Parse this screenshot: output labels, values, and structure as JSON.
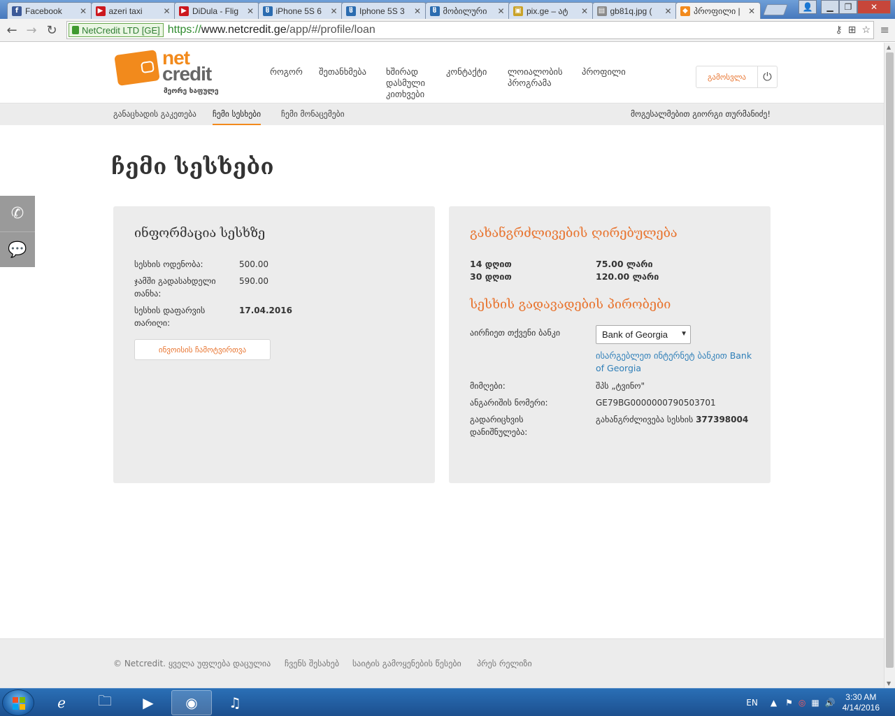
{
  "browser": {
    "tabs": [
      {
        "title": "Facebook",
        "favicon": "facebook-icon",
        "color": "#3b5998",
        "glyph": "f"
      },
      {
        "title": "azeri taxi",
        "favicon": "youtube-icon",
        "color": "#cc181e",
        "glyph": "▶"
      },
      {
        "title": "DiDula - Flig",
        "favicon": "youtube-icon",
        "color": "#cc181e",
        "glyph": "▶"
      },
      {
        "title": "iPhone 5S 6",
        "favicon": "ss-ge-icon",
        "color": "#2b6cb0",
        "glyph": "ჱ"
      },
      {
        "title": "Iphone 5S 3",
        "favicon": "ss-ge-icon",
        "color": "#2b6cb0",
        "glyph": "ჱ"
      },
      {
        "title": "მობილური",
        "favicon": "ss-ge-icon",
        "color": "#2b6cb0",
        "glyph": "ჱ"
      },
      {
        "title": "pix.ge – ატ",
        "favicon": "pix-ge-icon",
        "color": "#c9a227",
        "glyph": "▣"
      },
      {
        "title": "gb81q.jpg (",
        "favicon": "image-file-icon",
        "color": "#8a8a8a",
        "glyph": "▤"
      },
      {
        "title": "პროფილი |",
        "favicon": "netcredit-icon",
        "color": "#f28a1c",
        "glyph": "◆",
        "active": true
      }
    ],
    "ev_owner": "NetCredit LTD [GE]",
    "url_proto": "https://",
    "url_host": "www.netcredit.ge",
    "url_path": "/app/#/profile/loan"
  },
  "site": {
    "logo_net": "net",
    "logo_credit": "credit",
    "logo_tagline": "მეორე ხაფულე",
    "nav": [
      "როგორ",
      "შეთანხმება",
      "ხშირად დასმული კითხვები",
      "კონტაქტი",
      "ლოიალობის პროგრამა",
      "პროფილი"
    ],
    "logout_label": "გამოსვლა",
    "subnav": {
      "apply": "განაცხადის გაკეთება",
      "my_loans": "ჩემი სესხები",
      "my_data": "ჩემი მონაცემები",
      "greeting": "მოგესალმებით გიორგი თურმანიძე!"
    },
    "page_title": "ჩემი სესხები",
    "loan_info": {
      "heading": "ინფორმაცია სესხზე",
      "amount_label": "სესხის ოდენობა:",
      "amount_value": "500.00",
      "total_label": "ჯამში გადასახდელი თანხა:",
      "total_value": "590.00",
      "due_label": "სესხის დაფარვის თარიღი:",
      "due_value": "17.04.2016",
      "invoice_button": "ინვოისის ჩამოტვირთვა"
    },
    "extension": {
      "heading": "გახანგრძლივების ღირებულება",
      "rows": [
        {
          "period": "14 დღით",
          "price": "75.00 ლარი"
        },
        {
          "period": "30 დღით",
          "price": "120.00 ლარი"
        }
      ],
      "transfer_heading": "სესხის გადავადების პირობები",
      "choose_bank_label": "აირჩიეთ თქვენი ბანკი",
      "bank_selected": "Bank of Georgia",
      "bank_link": "ისარგებლეთ ინტერნეტ ბანკით Bank of Georgia",
      "recipient_label": "მიმღები:",
      "recipient_value": "შპს „ტვინო\"",
      "account_label": "ანგარიშის ნომერი:",
      "account_value": "GE79BG0000000790503701",
      "purpose_label": "გადარიცხვის დანიშნულება:",
      "purpose_prefix": "გახანგრძლივება სესხის",
      "purpose_number": "377398004"
    },
    "footer": {
      "copyright": "© Netcredit. ყველა უფლება დაცულია",
      "about": "ჩვენს შესახებ",
      "terms": "საიტის გამოყენების წესები",
      "press": "პრეს რელიზი"
    }
  },
  "taskbar": {
    "lang": "EN",
    "time": "3:30 AM",
    "date": "4/14/2016"
  },
  "colors": {
    "brand_orange": "#f28a1c",
    "accent_orange": "#e8742f",
    "link_blue": "#2f7fb8",
    "panel_gray": "#ececec"
  }
}
